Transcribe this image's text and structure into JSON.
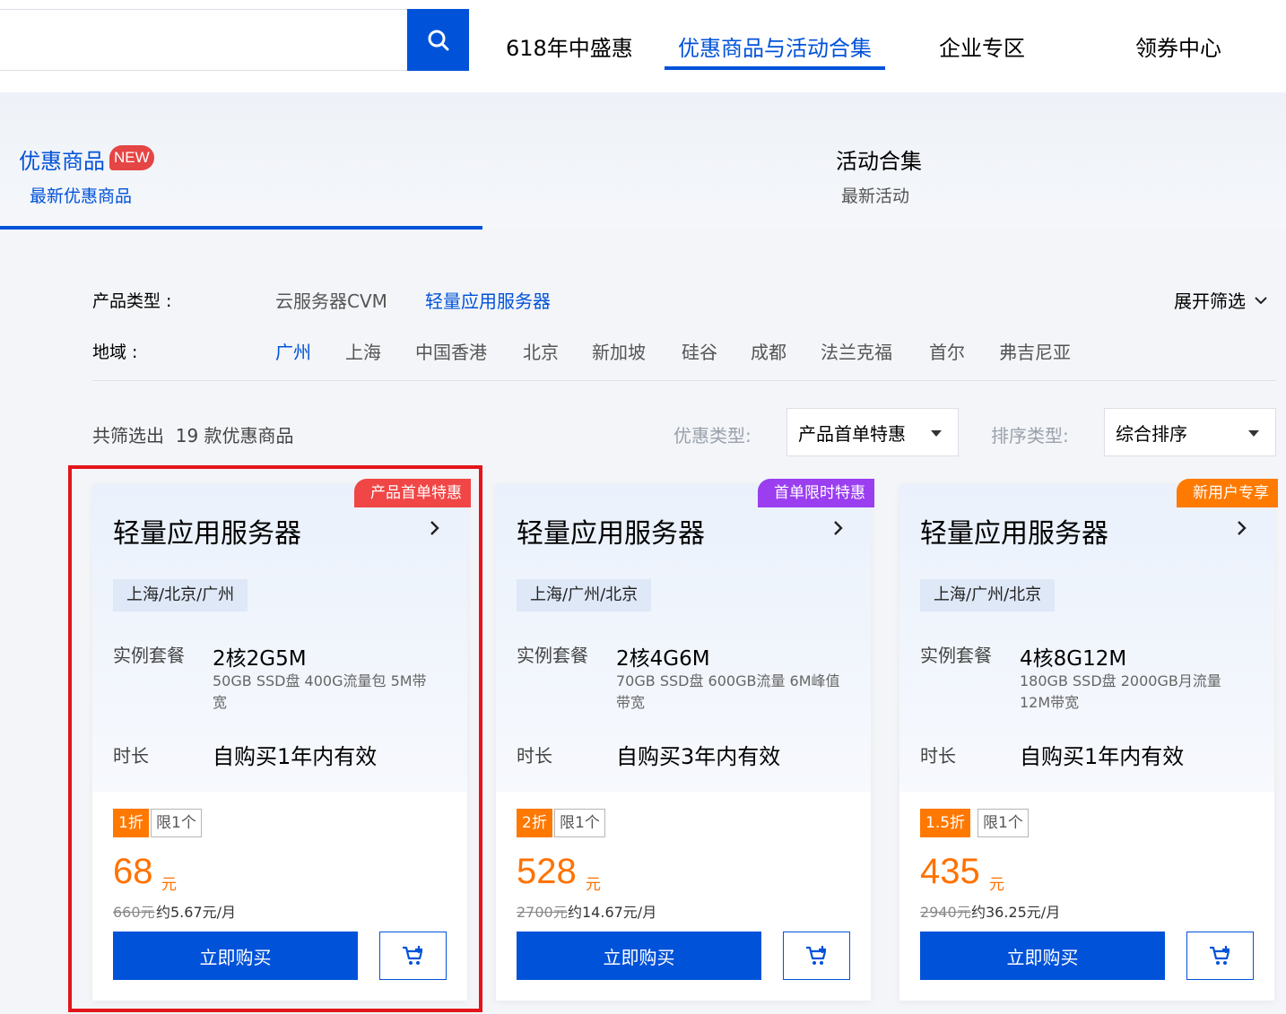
{
  "search": {
    "placeholder": "",
    "value": ""
  },
  "nav": [
    {
      "label": "618年中盛惠"
    },
    {
      "label": "优惠商品与活动合集"
    },
    {
      "label": "企业专区"
    },
    {
      "label": "领券中心"
    }
  ],
  "tabs": [
    {
      "title": "优惠商品",
      "badge": "NEW",
      "subtitle": "最新优惠商品"
    },
    {
      "title": "活动合集",
      "subtitle": "最新活动"
    }
  ],
  "filters": {
    "product_type_label": "产品类型 :",
    "product_types": [
      "云服务器CVM",
      "轻量应用服务器"
    ],
    "region_label": "地域 :",
    "regions": [
      "广州",
      "上海",
      "中国香港",
      "北京",
      "新加坡",
      "硅谷",
      "成都",
      "法兰克福",
      "首尔",
      "弗吉尼亚"
    ],
    "expand_label": "展开筛选"
  },
  "summary": {
    "count_text": "共筛选出  19 款优惠商品",
    "discount_type_label": "优惠类型:",
    "discount_type_value": "产品首单特惠",
    "sort_type_label": "排序类型:",
    "sort_type_value": "综合排序"
  },
  "colors": {
    "primary": "#0052d9",
    "price": "#ff7200",
    "highlight": "#e4141b"
  },
  "cards": [
    {
      "ribbon": "产品首单特惠",
      "ribbon_color": "#f04646",
      "title": "轻量应用服务器",
      "region": "上海/北京/广州",
      "spec_label": "实例套餐",
      "spec": "2核2G5M",
      "spec_detail": "50GB SSD盘 400G流量包 5M带宽",
      "duration_label": "时长",
      "duration": "自购买1年内有效",
      "discount": "1折",
      "limit": "限1个",
      "price": "68",
      "unit": "元",
      "original": "660元",
      "monthly": "约5.67元/月",
      "buy_label": "立即购买"
    },
    {
      "ribbon": "首单限时特惠",
      "ribbon_color": "#9a3ef0",
      "title": "轻量应用服务器",
      "region": "上海/广州/北京",
      "spec_label": "实例套餐",
      "spec": "2核4G6M",
      "spec_detail": "70GB SSD盘 600GB流量 6M峰值带宽",
      "duration_label": "时长",
      "duration": "自购买3年内有效",
      "discount": "2折",
      "limit": "限1个",
      "price": "528",
      "unit": "元",
      "original": "2700元",
      "monthly": "约14.67元/月",
      "buy_label": "立即购买"
    },
    {
      "ribbon": "新用户专享",
      "ribbon_color": "#ff7a00",
      "title": "轻量应用服务器",
      "region": "上海/广州/北京",
      "spec_label": "实例套餐",
      "spec": "4核8G12M",
      "spec_detail": "180GB SSD盘 2000GB月流量12M带宽",
      "duration_label": "时长",
      "duration": "自购买1年内有效",
      "discount": "1.5折",
      "limit": "限1个",
      "price": "435",
      "unit": "元",
      "original": "2940元",
      "monthly": "约36.25元/月",
      "buy_label": "立即购买"
    }
  ]
}
